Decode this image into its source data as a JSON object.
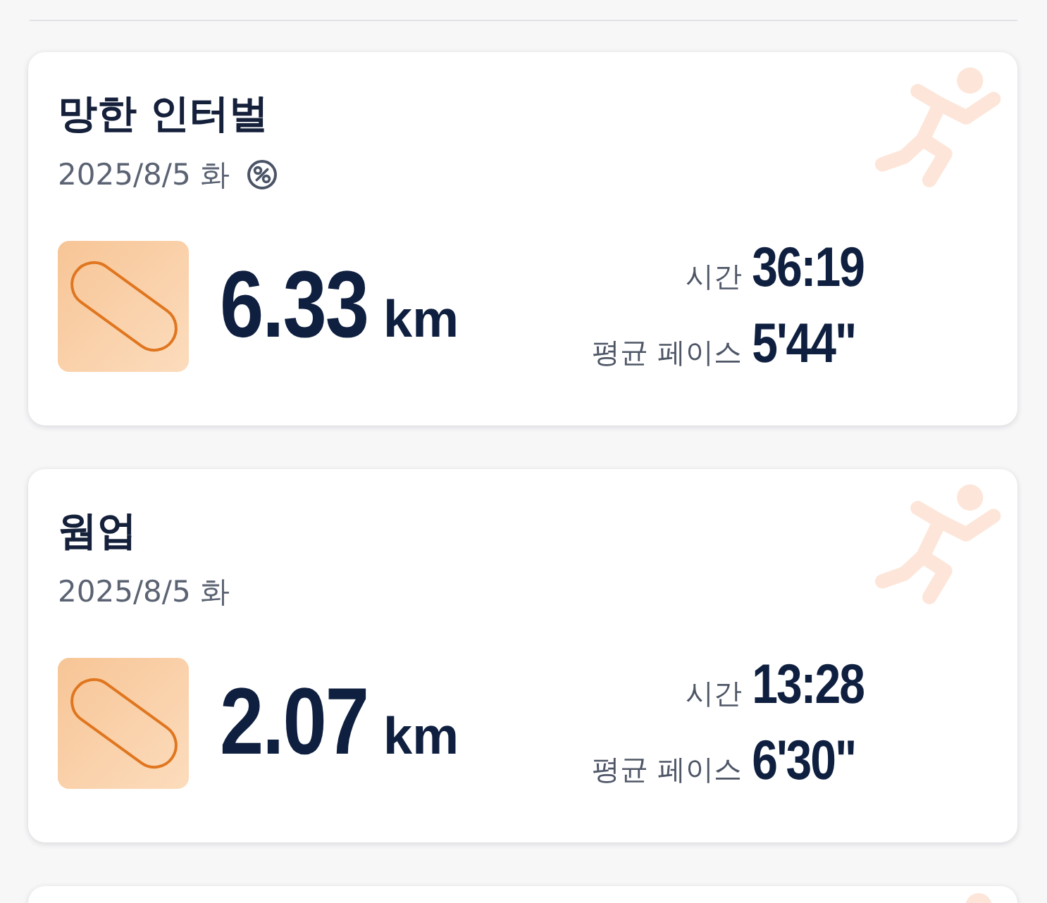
{
  "workouts": [
    {
      "kind": "summary",
      "title": "망한 인터벌",
      "date": "2025/8/5 화",
      "percent_badge": true,
      "distance": "6.33",
      "unit": "km",
      "stats": [
        {
          "label": "시간",
          "value": "36:19"
        },
        {
          "label": "평균 페이스",
          "value": "5'44\""
        }
      ]
    },
    {
      "kind": "summary",
      "title": "웜업",
      "date": "2025/8/5 화",
      "percent_badge": false,
      "distance": "2.07",
      "unit": "km",
      "stats": [
        {
          "label": "시간",
          "value": "13:28"
        },
        {
          "label": "평균 페이스",
          "value": "6'30\""
        }
      ]
    },
    {
      "kind": "cut_off"
    }
  ]
}
